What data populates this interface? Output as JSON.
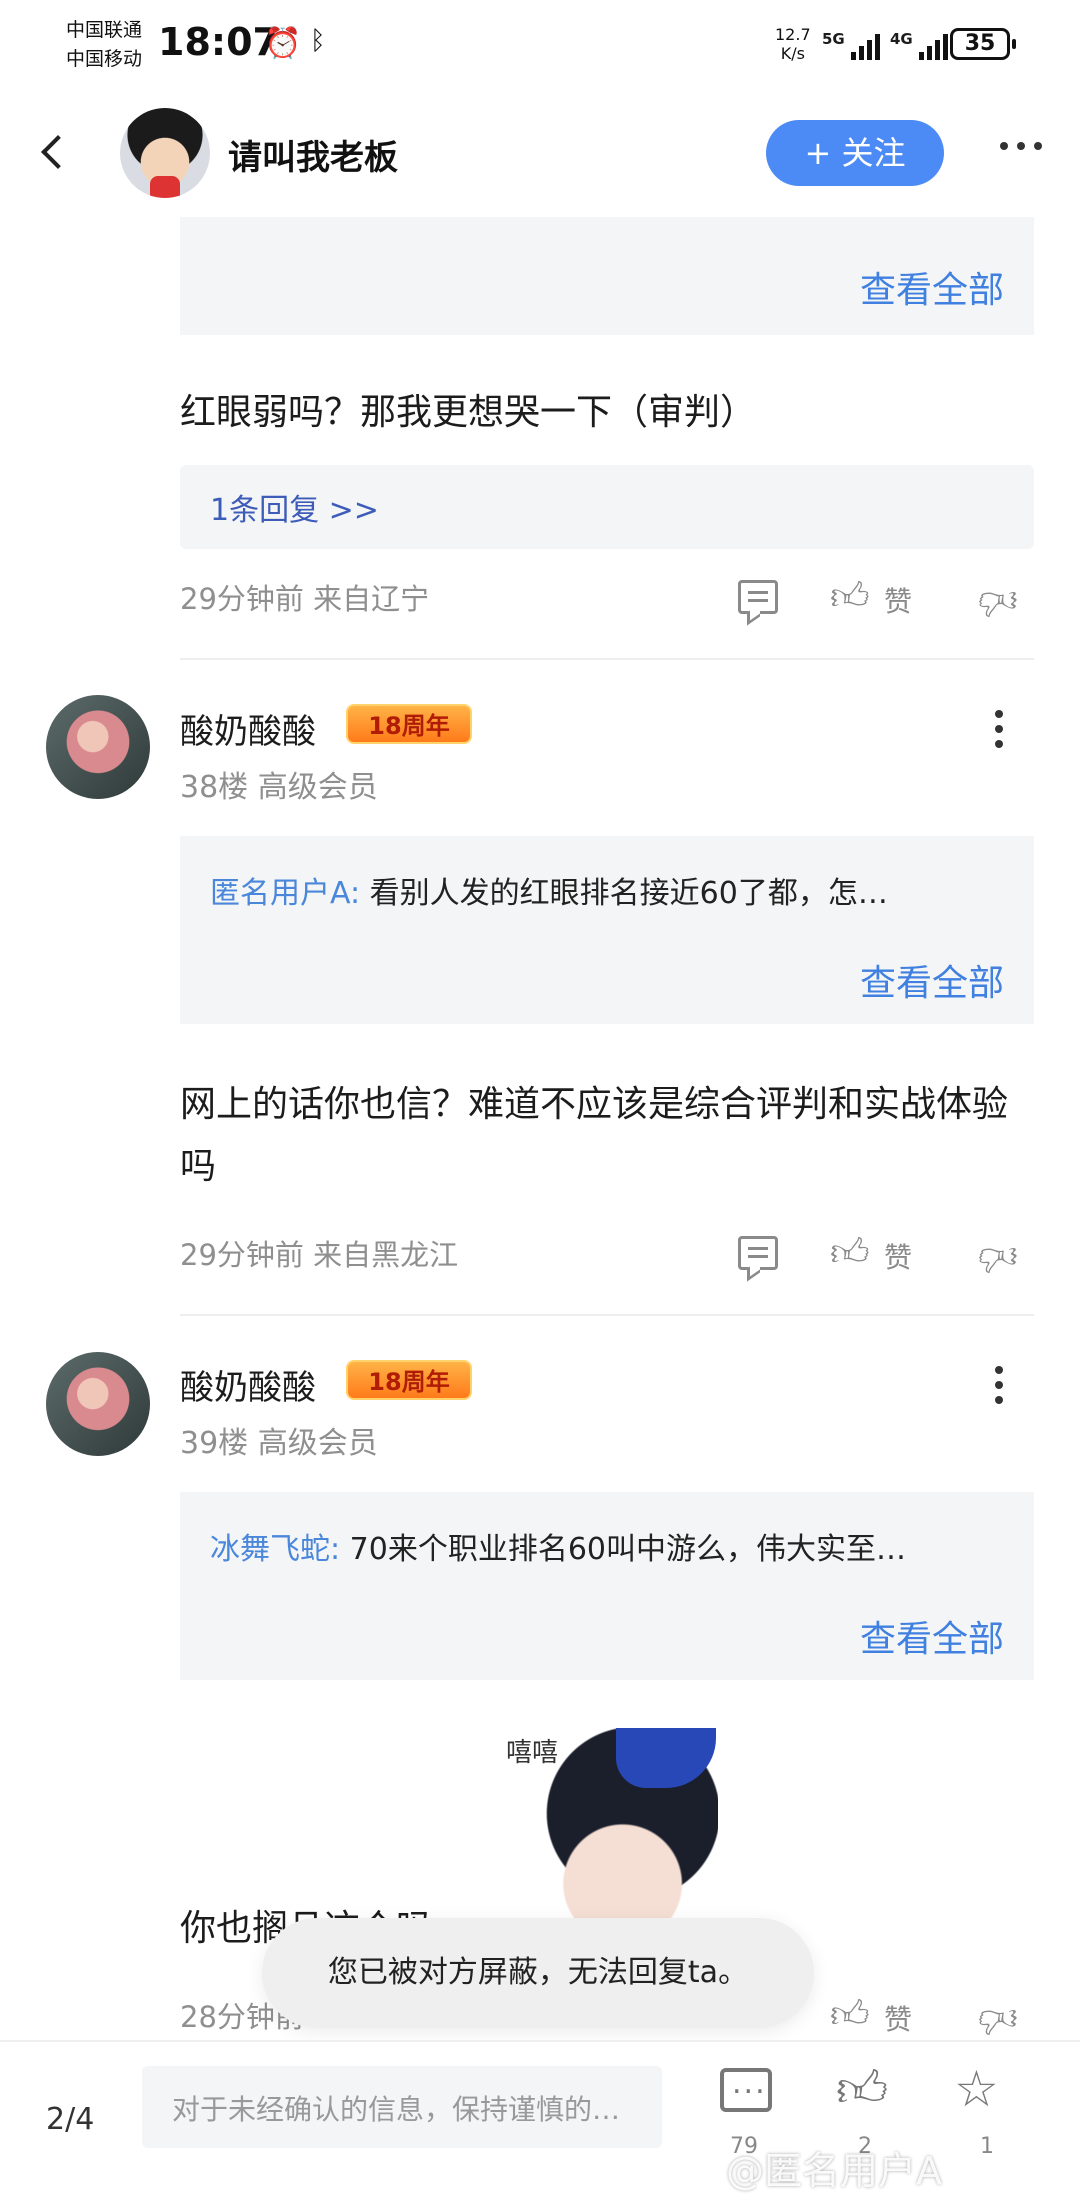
{
  "status_bar": {
    "carrier1": "中国联通",
    "carrier2": "中国移动",
    "time": "18:07",
    "net_speed_value": "12.7",
    "net_speed_unit": "K/s",
    "net1": "5G",
    "net2": "4G",
    "battery": "35"
  },
  "header": {
    "username": "请叫我老板",
    "follow_label": "+ 关注"
  },
  "posts": [
    {
      "view_all": "查看全部",
      "text": "红眼弱吗？那我更想哭一下（审判）",
      "reply_summary": "1条回复 >>",
      "meta": "29分钟前 来自辽宁",
      "like_label": "赞"
    },
    {
      "user": "酸奶酸酸",
      "badge": "18周年",
      "floor": "38楼 高级会员",
      "quote_user": "匿名用户A:",
      "quote_text": "看别人发的红眼排名接近60了都，怎…",
      "view_all": "查看全部",
      "text": "网上的话你也信？难道不应该是综合评判和实战体验吗",
      "meta": "29分钟前 来自黑龙江",
      "like_label": "赞"
    },
    {
      "user": "酸奶酸酸",
      "badge": "18周年",
      "floor": "39楼 高级会员",
      "quote_user": "冰舞飞蛇:",
      "quote_text": "70来个职业排名60叫中游么，伟大实至…",
      "view_all": "查看全部",
      "sticker_text": "嘻嘻",
      "text": "你也搁且这个吗",
      "meta": "28分钟前",
      "like_label": "赞"
    }
  ],
  "toast": "您已被对方屏蔽，无法回复ta。",
  "bottom_bar": {
    "page_indicator": "2/4",
    "input_placeholder": "对于未经确认的信息，保持谨慎的…",
    "comment_count": "79",
    "like_count": "2",
    "favorite_count": "1"
  },
  "watermark": "@匿名用户A"
}
